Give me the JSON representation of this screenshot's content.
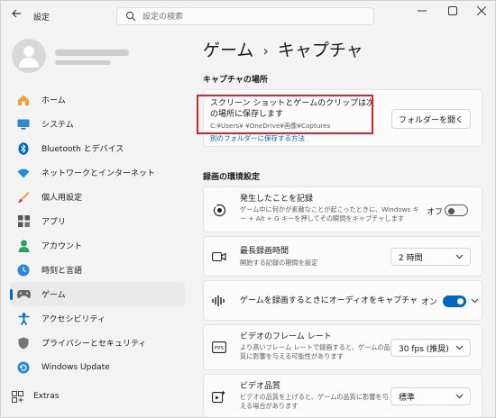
{
  "app": {
    "title": "設定"
  },
  "search": {
    "placeholder": "設定の検索"
  },
  "nav": {
    "items": [
      {
        "label": "ホーム"
      },
      {
        "label": "システム"
      },
      {
        "label": "Bluetooth とデバイス"
      },
      {
        "label": "ネットワークとインターネット"
      },
      {
        "label": "個人用設定"
      },
      {
        "label": "アプリ"
      },
      {
        "label": "アカウント"
      },
      {
        "label": "時刻と言語"
      },
      {
        "label": "ゲーム"
      },
      {
        "label": "アクセシビリティ"
      },
      {
        "label": "プライバシーとセキュリティ"
      },
      {
        "label": "Windows Update"
      }
    ],
    "extras": "Extras"
  },
  "breadcrumb": {
    "parent": "ゲーム",
    "separator": "›",
    "current": "キャプチャ"
  },
  "capture_location": {
    "section_title": "キャプチャの場所",
    "description": "スクリーン ショットとゲームのクリップは次の場所に保存します",
    "path": "C:¥Users¥        ¥OneDrive¥画像¥Captures",
    "open_folder_button": "フォルダーを開く",
    "other_folder_link": "別のフォルダーに保存する方法"
  },
  "recording": {
    "section_title": "録画の環境設定",
    "rows": [
      {
        "title": "発生したことを記録",
        "description": "ゲーム中に何かが素敵なことが起こったときに、Windows キー + Alt + G キーを押してその瞬間をキャプチャします",
        "control": "オフ"
      },
      {
        "title": "最長録画時間",
        "description": "開始する記録の期間を設定",
        "control": "2 時間"
      },
      {
        "title": "ゲームを録画するときにオーディオをキャプチャ",
        "description": "",
        "control": "オン"
      },
      {
        "title": "ビデオのフレーム レート",
        "description": "より高いフレーム レートで録画すると、ゲームの品質に影響を与える可能性があります",
        "control": "30 fps (推奨)"
      },
      {
        "title": "ビデオ品質",
        "description": "ビデオの品質を上げると、ゲームの品質に影響を与える場合があります",
        "control": "標準"
      }
    ]
  },
  "colors": {
    "accent": "#0067c0",
    "highlight": "#d9232e"
  }
}
